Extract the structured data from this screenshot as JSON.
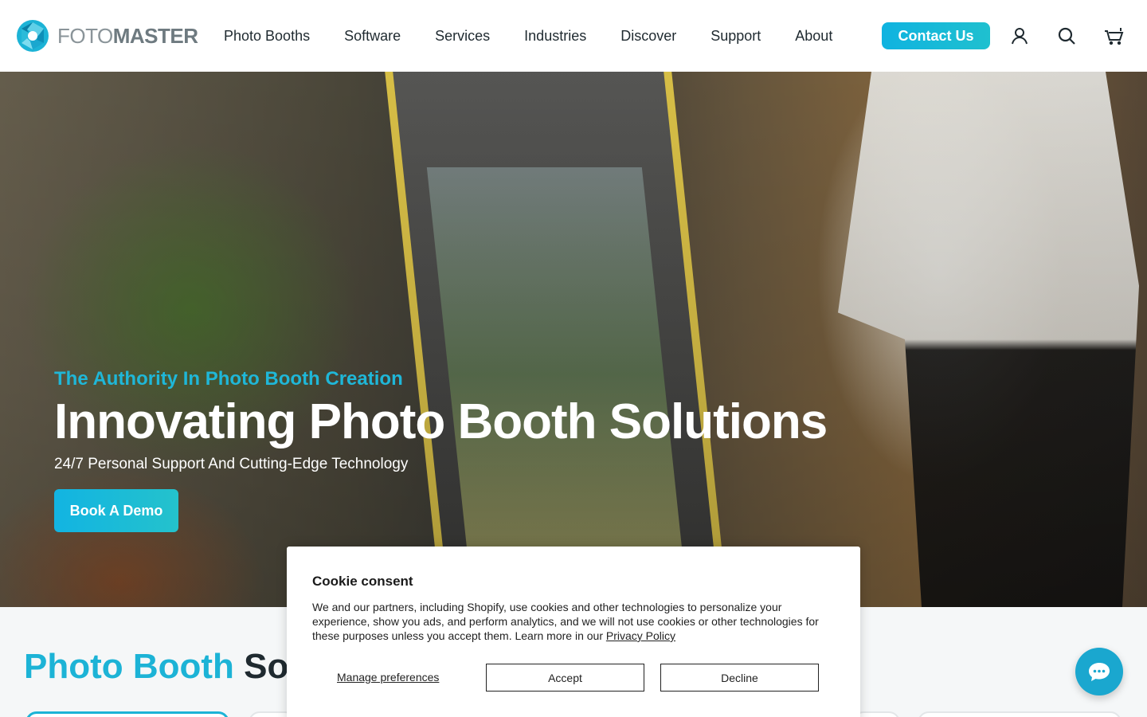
{
  "header": {
    "logo_light": "FOTO",
    "logo_bold": "MASTER",
    "nav": [
      "Photo Booths",
      "Software",
      "Services",
      "Industries",
      "Discover",
      "Support",
      "About"
    ],
    "contact_label": "Contact Us",
    "icons": [
      "account-icon",
      "search-icon",
      "cart-icon"
    ]
  },
  "hero": {
    "eyebrow": "The Authority In Photo Booth Creation",
    "title": "Innovating Photo Booth Solutions",
    "subtitle": "24/7 Personal Support And Cutting-Edge Technology",
    "cta_label": "Book A Demo"
  },
  "section": {
    "title_accent": "Photo Booth",
    "title_rest": "Solu"
  },
  "cookie": {
    "title": "Cookie consent",
    "body": "We and our partners, including Shopify, use cookies and other technologies to personalize your experience, show you ads, and perform analytics, and we will not use cookies or other technologies for these purposes unless you accept them. Learn more in our ",
    "policy_link": "Privacy Policy",
    "manage_label": "Manage preferences",
    "accept_label": "Accept",
    "decline_label": "Decline"
  },
  "colors": {
    "accent": "#1cb3d6",
    "text_dark": "#1f2a30"
  }
}
